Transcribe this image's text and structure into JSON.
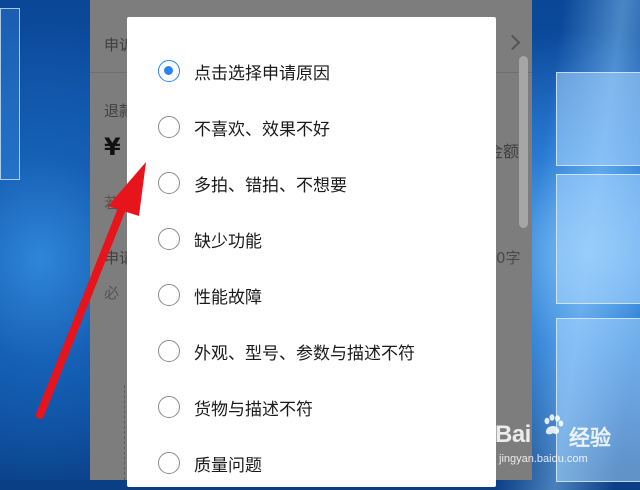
{
  "background_app": {
    "row1_label": "申诉",
    "row2_label": "退款",
    "currency": "¥",
    "amount_suffix": "金额",
    "row3_label": "若",
    "row4_label": "申请",
    "row4_suffix": "0字",
    "row5_label": "必"
  },
  "dialog": {
    "options": [
      {
        "label": "点击选择申请原因",
        "checked": true
      },
      {
        "label": "不喜欢、效果不好",
        "checked": false
      },
      {
        "label": "多拍、错拍、不想要",
        "checked": false
      },
      {
        "label": "缺少功能",
        "checked": false
      },
      {
        "label": "性能故障",
        "checked": false
      },
      {
        "label": "外观、型号、参数与描述不符",
        "checked": false
      },
      {
        "label": "货物与描述不符",
        "checked": false
      },
      {
        "label": "质量问题",
        "checked": false
      }
    ]
  },
  "annotation": {
    "arrow_color": "#e8141c"
  },
  "watermark": {
    "brand": "Bai",
    "brand_cn": "经验",
    "url": "jingyan.baidu.com"
  },
  "colors": {
    "radio_checked": "#2a83f5",
    "radio_unchecked": "#8a8a8a"
  }
}
